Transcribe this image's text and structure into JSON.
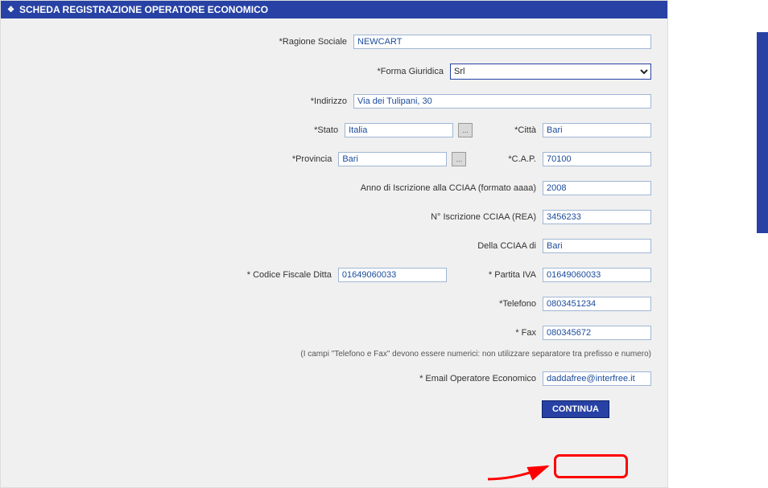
{
  "header": {
    "title": "SCHEDA REGISTRAZIONE OPERATORE ECONOMICO"
  },
  "labels": {
    "ragione_sociale": "*Ragione Sociale",
    "forma_giuridica": "*Forma Giuridica",
    "indirizzo": "*Indirizzo",
    "stato": "*Stato",
    "citta": "*Città",
    "provincia": "*Provincia",
    "cap": "*C.A.P.",
    "anno_cciaa": "Anno di Iscrizione alla CCIAA (formato aaaa)",
    "n_cciaa": "N° Iscrizione CCIAA (REA)",
    "della_cciaa": "Della CCIAA di",
    "codice_fiscale": "* Codice Fiscale Ditta",
    "partita_iva": "* Partita IVA",
    "telefono": "*Telefono",
    "fax": "* Fax",
    "email": "* Email Operatore Economico",
    "hint": "(I campi \"Telefono e Fax\" devono essere numerici: non utilizzare separatore tra prefisso e numero)"
  },
  "values": {
    "ragione_sociale": "NEWCART",
    "forma_giuridica": "Srl",
    "indirizzo": "Via dei Tulipani, 30",
    "stato": "Italia",
    "citta": "Bari",
    "provincia": "Bari",
    "cap": "70100",
    "anno_cciaa": "2008",
    "n_cciaa": "3456233",
    "della_cciaa": "Bari",
    "codice_fiscale": "01649060033",
    "partita_iva": "01649060033",
    "telefono": "0803451234",
    "fax": "080345672",
    "email": "daddafree@interfree.it"
  },
  "picker_glyph": "...",
  "buttons": {
    "continua": "CONTINUA"
  }
}
